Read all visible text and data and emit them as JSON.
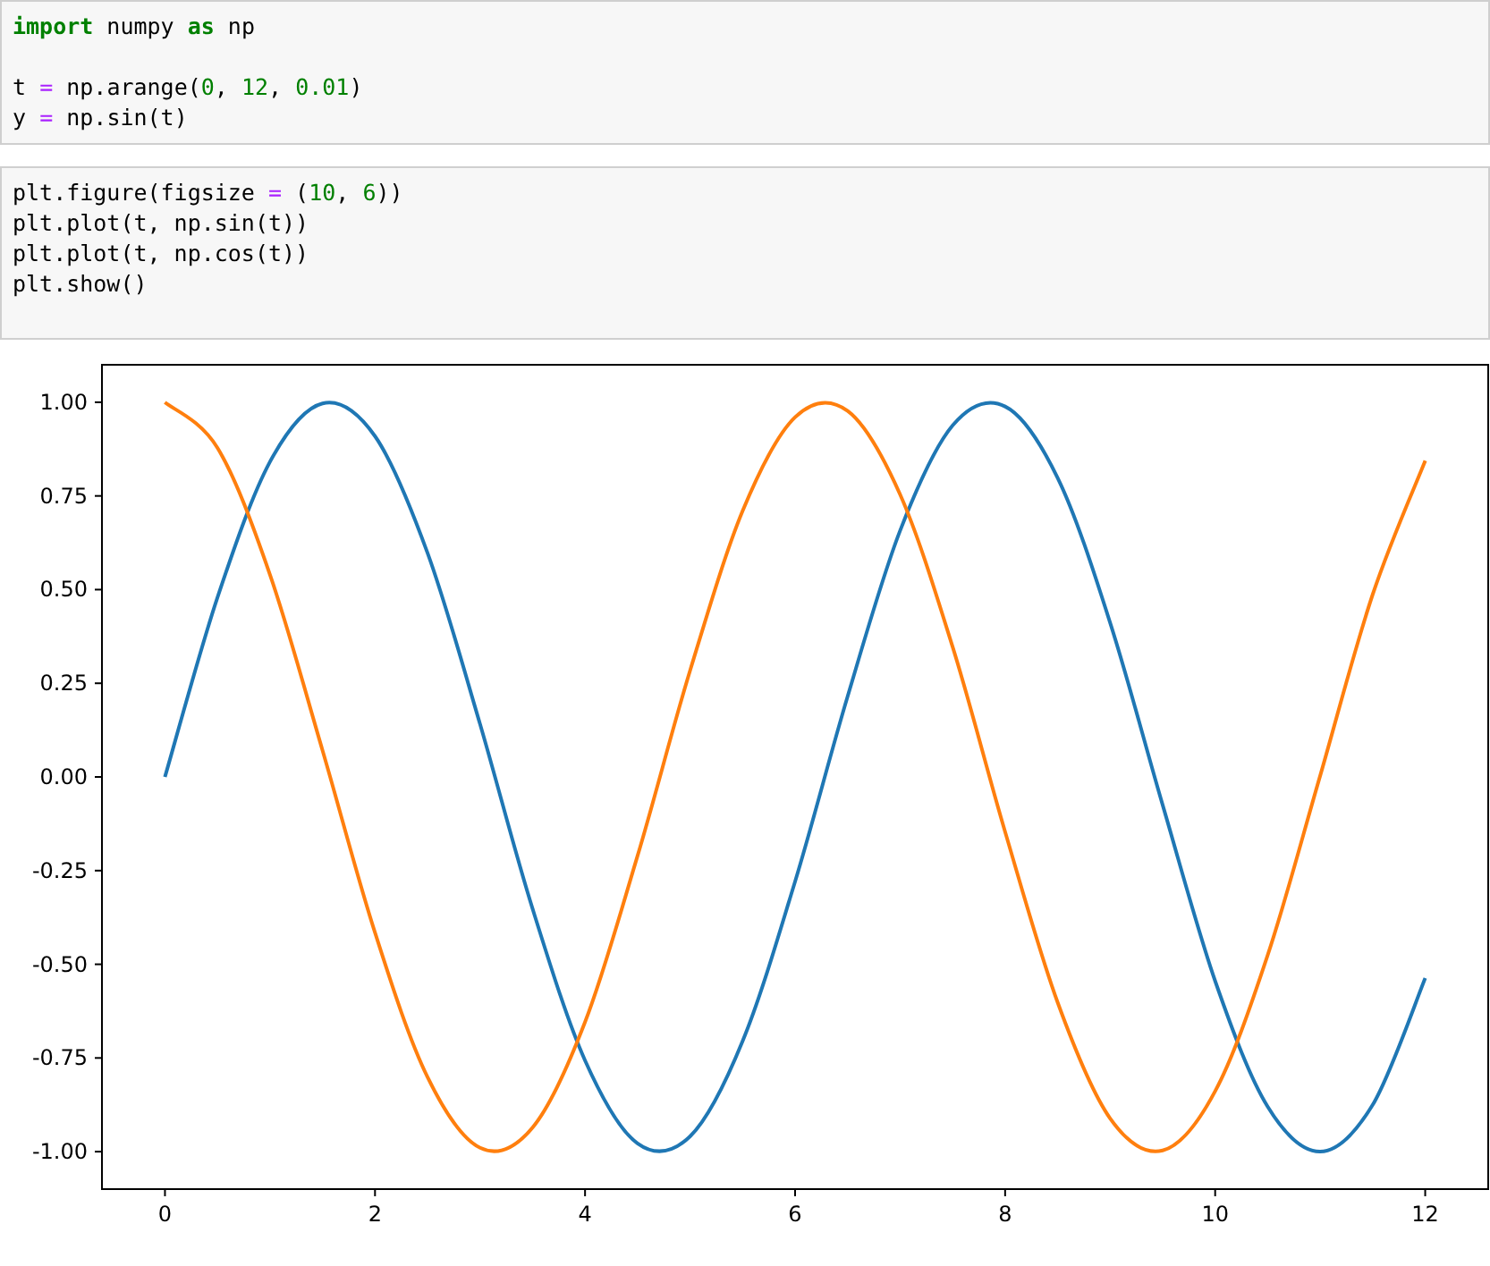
{
  "cells": [
    {
      "lines": [
        {
          "gap_before": false,
          "tokens": [
            {
              "kind": "keyword",
              "text": "import"
            },
            {
              "kind": "plain",
              "text": " numpy "
            },
            {
              "kind": "keyword",
              "text": "as"
            },
            {
              "kind": "plain",
              "text": " np"
            }
          ]
        },
        {
          "gap_before": true,
          "tokens": [
            {
              "kind": "plain",
              "text": "t "
            },
            {
              "kind": "operator",
              "text": "="
            },
            {
              "kind": "plain",
              "text": " np.arange("
            },
            {
              "kind": "number",
              "text": "0"
            },
            {
              "kind": "plain",
              "text": ", "
            },
            {
              "kind": "number",
              "text": "12"
            },
            {
              "kind": "plain",
              "text": ", "
            },
            {
              "kind": "number",
              "text": "0.01"
            },
            {
              "kind": "plain",
              "text": ")"
            }
          ]
        },
        {
          "gap_before": false,
          "tokens": [
            {
              "kind": "plain",
              "text": "y "
            },
            {
              "kind": "operator",
              "text": "="
            },
            {
              "kind": "plain",
              "text": " np.sin(t)"
            }
          ]
        }
      ]
    },
    {
      "lines": [
        {
          "gap_before": false,
          "tokens": [
            {
              "kind": "plain",
              "text": "plt.figure(figsize "
            },
            {
              "kind": "operator",
              "text": "="
            },
            {
              "kind": "plain",
              "text": " ("
            },
            {
              "kind": "number",
              "text": "10"
            },
            {
              "kind": "plain",
              "text": ", "
            },
            {
              "kind": "number",
              "text": "6"
            },
            {
              "kind": "plain",
              "text": "))"
            }
          ]
        },
        {
          "gap_before": false,
          "tokens": [
            {
              "kind": "plain",
              "text": "plt.plot(t, np.sin(t))"
            }
          ]
        },
        {
          "gap_before": false,
          "tokens": [
            {
              "kind": "plain",
              "text": "plt.plot(t, np.cos(t))"
            }
          ]
        },
        {
          "gap_before": false,
          "tokens": [
            {
              "kind": "plain",
              "text": "plt.show()"
            }
          ]
        }
      ]
    }
  ],
  "chart_data": {
    "type": "line",
    "x": [
      0,
      0.5,
      1,
      1.5,
      2,
      2.5,
      3,
      3.5,
      4,
      4.5,
      5,
      5.5,
      6,
      6.5,
      7,
      7.5,
      8,
      8.5,
      9,
      9.5,
      10,
      10.5,
      11,
      11.5,
      12
    ],
    "series": [
      {
        "color": "#1f77b4",
        "values": [
          0,
          0.479,
          0.841,
          0.997,
          0.909,
          0.598,
          0.141,
          -0.351,
          -0.757,
          -0.978,
          -0.959,
          -0.706,
          -0.279,
          0.215,
          0.657,
          0.938,
          0.989,
          0.798,
          0.412,
          -0.075,
          -0.544,
          -0.88,
          -1.0,
          -0.875,
          -0.537
        ]
      },
      {
        "color": "#ff7f0e",
        "values": [
          1,
          0.878,
          0.54,
          0.071,
          -0.416,
          -0.801,
          -0.99,
          -0.936,
          -0.654,
          -0.211,
          0.284,
          0.709,
          0.96,
          0.977,
          0.754,
          0.347,
          -0.146,
          -0.602,
          -0.911,
          -0.997,
          -0.839,
          -0.476,
          0.004,
          0.487,
          0.844
        ]
      }
    ],
    "xlim": [
      -0.6,
      12.6
    ],
    "ylim": [
      -1.1,
      1.1
    ],
    "xticks": [
      {
        "value": 0,
        "label": "0"
      },
      {
        "value": 2,
        "label": "2"
      },
      {
        "value": 4,
        "label": "4"
      },
      {
        "value": 6,
        "label": "6"
      },
      {
        "value": 8,
        "label": "8"
      },
      {
        "value": 10,
        "label": "10"
      },
      {
        "value": 12,
        "label": "12"
      }
    ],
    "yticks": [
      {
        "value": 1,
        "label": "1.00"
      },
      {
        "value": 0.75,
        "label": "0.75"
      },
      {
        "value": 0.5,
        "label": "0.50"
      },
      {
        "value": 0.25,
        "label": "0.25"
      },
      {
        "value": 0,
        "label": "0.00"
      },
      {
        "value": -0.25,
        "label": "-0.25"
      },
      {
        "value": -0.5,
        "label": "-0.50"
      },
      {
        "value": -0.75,
        "label": "-0.75"
      },
      {
        "value": -1,
        "label": "-1.00"
      }
    ]
  }
}
